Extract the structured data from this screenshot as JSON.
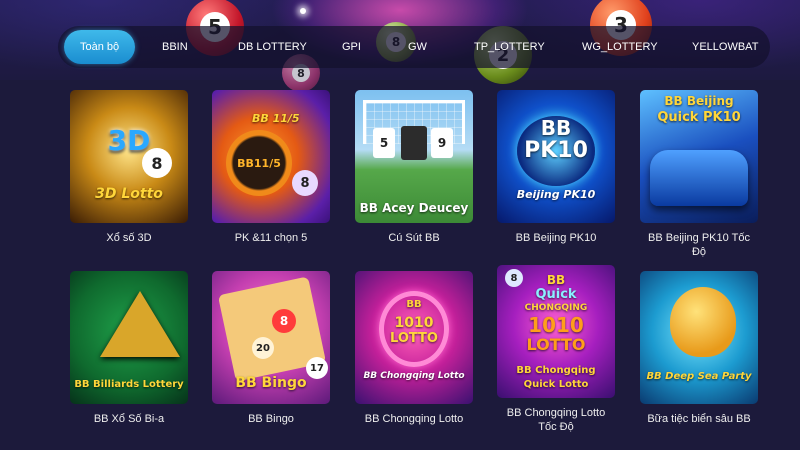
{
  "tabs": [
    {
      "label": "Toàn bộ",
      "active": true
    },
    {
      "label": "BBIN",
      "active": false
    },
    {
      "label": "DB LOTTERY",
      "active": false
    },
    {
      "label": "GPI",
      "active": false
    },
    {
      "label": "GW",
      "active": false
    },
    {
      "label": "TP_LOTTERY",
      "active": false
    },
    {
      "label": "WG_LOTTERY",
      "active": false
    },
    {
      "label": "YELLOWBAT",
      "active": false
    }
  ],
  "hero_balls": [
    "5",
    "8",
    "8",
    "2",
    "3"
  ],
  "games": [
    {
      "title": "Xổ số 3D",
      "art": [
        "3D",
        "3D Lotto",
        "8"
      ]
    },
    {
      "title": "PK &11 chọn 5",
      "art": [
        "BB 11/5",
        "BB11/5",
        "8"
      ]
    },
    {
      "title": "Cú Sút BB",
      "art": [
        "5",
        "9",
        "BB Acey Deucey"
      ]
    },
    {
      "title": "BB Beijing PK10",
      "art": [
        "BB",
        "PK10",
        "Beijing PK10"
      ]
    },
    {
      "title": "BB Beijing PK10 Tốc Độ",
      "art": [
        "BB Beijing",
        "Quick PK10"
      ]
    },
    {
      "title": "BB Xổ Số Bi-a",
      "art": [
        "BB Billiards Lottery"
      ]
    },
    {
      "title": "BB Bingo",
      "art": [
        "20",
        "8",
        "17",
        "BB Bingo"
      ]
    },
    {
      "title": "BB Chongqing Lotto",
      "art": [
        "BB",
        "1010",
        "LOTTO",
        "BB Chongqing Lotto"
      ]
    },
    {
      "title": "BB Chongqing Lotto Tốc Độ",
      "art": [
        "BB",
        "Quick",
        "CHONGQING",
        "1010",
        "LOTTO",
        "BB Chongqing",
        "Quick Lotto",
        "8"
      ]
    },
    {
      "title": "Bữa tiệc biển sâu BB",
      "art": [
        "BB Deep Sea Party"
      ]
    }
  ],
  "colors": {
    "background": "#1c1a3b",
    "active_tab": "#2aa3e0"
  }
}
